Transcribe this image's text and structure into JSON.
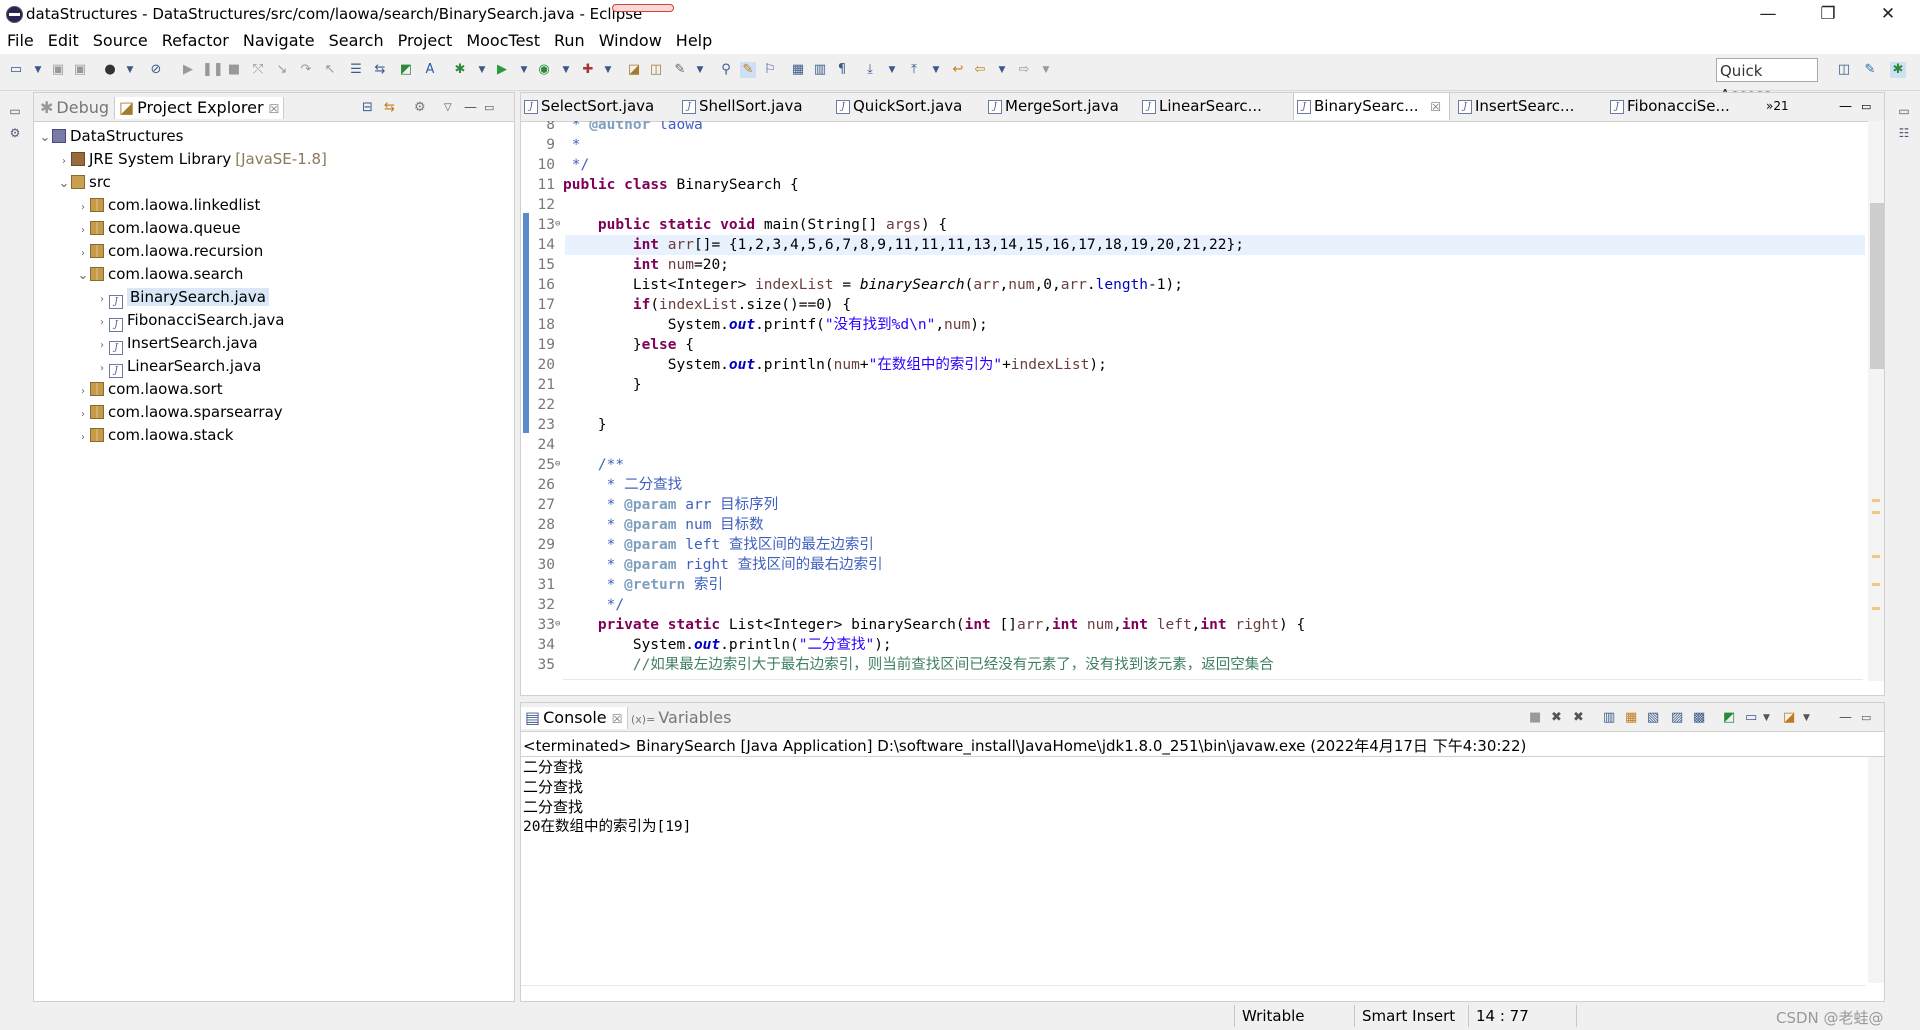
{
  "window": {
    "title": "dataStructures - DataStructures/src/com/laowa/search/BinarySearch.java - Eclipse",
    "minimize": "—",
    "maximize": "❐",
    "close": "✕"
  },
  "menu": [
    "File",
    "Edit",
    "Source",
    "Refactor",
    "Navigate",
    "Search",
    "Project",
    "MoocTest",
    "Run",
    "Window",
    "Help"
  ],
  "toolbar": {
    "quick_access": "Quick Access"
  },
  "left_panel": {
    "tab_debug": "Debug",
    "tab_explorer": "Project Explorer",
    "tab_close": "☒",
    "tree": [
      {
        "label": "DataStructures",
        "level": 0,
        "expanded": true,
        "icon": "project-icon"
      },
      {
        "label": "JRE System Library",
        "suffix": "[JavaSE-1.8]",
        "level": 1,
        "expanded": false,
        "icon": "library-icon"
      },
      {
        "label": "src",
        "level": 1,
        "expanded": true,
        "icon": "source-folder-icon"
      },
      {
        "label": "com.laowa.linkedlist",
        "level": 2,
        "expanded": false,
        "icon": "package-icon"
      },
      {
        "label": "com.laowa.queue",
        "level": 2,
        "expanded": false,
        "icon": "package-icon"
      },
      {
        "label": "com.laowa.recursion",
        "level": 2,
        "expanded": false,
        "icon": "package-icon"
      },
      {
        "label": "com.laowa.search",
        "level": 2,
        "expanded": true,
        "icon": "package-icon"
      },
      {
        "label": "BinarySearch.java",
        "level": 3,
        "expanded": false,
        "icon": "java-file-icon",
        "selected": true
      },
      {
        "label": "FibonacciSearch.java",
        "level": 3,
        "expanded": false,
        "icon": "java-file-icon"
      },
      {
        "label": "InsertSearch.java",
        "level": 3,
        "expanded": false,
        "icon": "java-file-icon"
      },
      {
        "label": "LinearSearch.java",
        "level": 3,
        "expanded": false,
        "icon": "java-file-icon"
      },
      {
        "label": "com.laowa.sort",
        "level": 2,
        "expanded": false,
        "icon": "package-icon"
      },
      {
        "label": "com.laowa.sparsearray",
        "level": 2,
        "expanded": false,
        "icon": "package-icon"
      },
      {
        "label": "com.laowa.stack",
        "level": 2,
        "expanded": false,
        "icon": "package-icon"
      }
    ]
  },
  "editor": {
    "tabs": [
      {
        "label": "SelectSort.java"
      },
      {
        "label": "ShellSort.java"
      },
      {
        "label": "QuickSort.java"
      },
      {
        "label": "MergeSort.java"
      },
      {
        "label": "LinearSearc..."
      },
      {
        "label": "BinarySearc...",
        "active": true
      },
      {
        "label": "InsertSearc..."
      },
      {
        "label": "FibonacciSe..."
      }
    ],
    "overflow": "»21",
    "lines": [
      {
        "n": "8",
        "html": "<span class=\"cm\"> * </span><span class=\"tag\">@author</span><span class=\"cm\"> laowa</span>"
      },
      {
        "n": "9",
        "html": "<span class=\"cm\"> *</span>"
      },
      {
        "n": "10",
        "html": "<span class=\"cm\"> */</span>"
      },
      {
        "n": "11",
        "html": "<span class=\"kw\">public</span> <span class=\"kw\">class</span> BinarySearch {"
      },
      {
        "n": "12",
        "html": ""
      },
      {
        "n": "13",
        "fold": true,
        "html": "    <span class=\"kw\">public</span> <span class=\"kw\">static</span> <span class=\"kw\">void</span> main(String[] <span class=\"var\">args</span>) {"
      },
      {
        "n": "14",
        "current": true,
        "html": "        <span class=\"kw\">int</span> <span class=\"var\">arr</span>[]= {1,2,3,4,5,6,7,8,9,11,11,11,13,14,15,16,17,18,19,20,21,22};"
      },
      {
        "n": "15",
        "html": "        <span class=\"kw\">int</span> <span class=\"var\">num</span>=20;"
      },
      {
        "n": "16",
        "html": "        List&lt;Integer&gt; <span class=\"var\">indexList</span> = <span class=\"mth\">binarySearch</span>(<span class=\"var\">arr</span>,<span class=\"var\">num</span>,0,<span class=\"var\">arr</span>.<span style=\"color:#0000c0\">length</span>-1);"
      },
      {
        "n": "17",
        "html": "        <span class=\"kw\">if</span>(<span class=\"var\">indexList</span>.size()==0) {"
      },
      {
        "n": "18",
        "html": "            System.<span class=\"fld\">out</span>.printf(<span class=\"str\">\"没有找到%d\\n\"</span>,<span class=\"var\">num</span>);"
      },
      {
        "n": "19",
        "html": "        }<span class=\"kw\">else</span> {"
      },
      {
        "n": "20",
        "html": "            System.<span class=\"fld\">out</span>.println(<span class=\"var\">num</span>+<span class=\"str\">\"在数组中的索引为\"</span>+<span class=\"var\">indexList</span>);"
      },
      {
        "n": "21",
        "html": "        }"
      },
      {
        "n": "22",
        "html": ""
      },
      {
        "n": "23",
        "html": "    }"
      },
      {
        "n": "24",
        "html": ""
      },
      {
        "n": "25",
        "fold": true,
        "html": "    <span class=\"cm\">/**</span>"
      },
      {
        "n": "26",
        "html": "<span class=\"cm\">     * 二分查找</span>"
      },
      {
        "n": "27",
        "html": "<span class=\"cm\">     * </span><span class=\"tag\">@param</span><span class=\"cm\"> arr 目标序列</span>"
      },
      {
        "n": "28",
        "html": "<span class=\"cm\">     * </span><span class=\"tag\">@param</span><span class=\"cm\"> num 目标数</span>"
      },
      {
        "n": "29",
        "html": "<span class=\"cm\">     * </span><span class=\"tag\">@param</span><span class=\"cm\"> left 查找区间的最左边索引</span>"
      },
      {
        "n": "30",
        "html": "<span class=\"cm\">     * </span><span class=\"tag\">@param</span><span class=\"cm\"> right 查找区间的最右边索引</span>"
      },
      {
        "n": "31",
        "html": "<span class=\"cm\">     * </span><span class=\"tag\">@return</span><span class=\"cm\"> 索引</span>"
      },
      {
        "n": "32",
        "html": "<span class=\"cm\">     */</span>"
      },
      {
        "n": "33",
        "fold": true,
        "html": "    <span class=\"kw\">private</span> <span class=\"kw\">static</span> List&lt;Integer&gt; binarySearch(<span class=\"kw\">int</span> []<span class=\"var\">arr</span>,<span class=\"kw\">int</span> <span class=\"var\">num</span>,<span class=\"kw\">int</span> <span class=\"var\">left</span>,<span class=\"kw\">int</span> <span class=\"var\">right</span>) {"
      },
      {
        "n": "34",
        "html": "        System.<span class=\"fld\">out</span>.println(<span class=\"str\">\"二分查找\"</span>);"
      },
      {
        "n": "35",
        "html": "        <span class=\"cm2\">//如果最左边索引大于最右边索引，则当前查找区间已经没有元素了，没有找到该元素，返回空集合</span>"
      }
    ]
  },
  "console": {
    "tab_console": "Console",
    "tab_variables": "Variables",
    "terminated": "<terminated> BinarySearch [Java Application] D:\\software_install\\JavaHome\\jdk1.8.0_251\\bin\\javaw.exe (2022年4月17日 下午4:30:22)",
    "output": [
      "二分查找",
      "二分查找",
      "二分查找",
      "20在数组中的索引为[19]"
    ]
  },
  "status": {
    "writable": "Writable",
    "insert_mode": "Smart Insert",
    "position": "14 : 77",
    "watermark": "CSDN @老蛙@"
  }
}
